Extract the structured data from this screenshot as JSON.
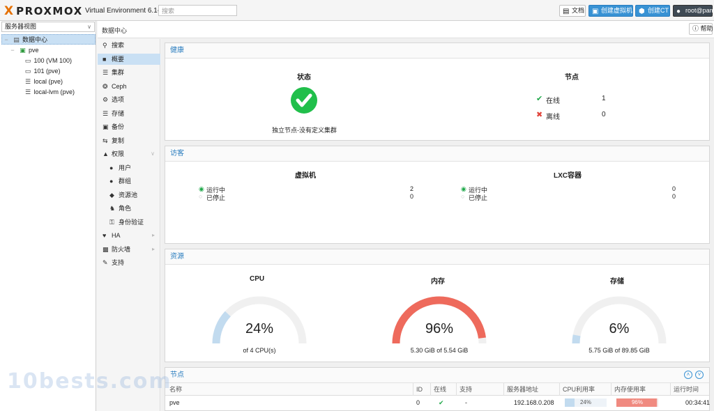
{
  "header": {
    "logo_x": "X",
    "logo_text": "PROXMOX",
    "version": "Virtual Environment 6.1-7",
    "search_placeholder": "搜索",
    "btn_docs": "文档",
    "btn_create_vm": "创建虚拟机",
    "btn_create_ct": "创建CT",
    "btn_user": "root@pam"
  },
  "tree": {
    "view_selector": "服务器视图",
    "items": [
      {
        "label": "数据中心"
      },
      {
        "label": "pve"
      },
      {
        "label": "100 (VM 100)"
      },
      {
        "label": "101 (pve)"
      },
      {
        "label": "local (pve)"
      },
      {
        "label": "local-lvm (pve)"
      }
    ]
  },
  "breadcrumb": "数据中心",
  "help_label": "帮助",
  "menu": {
    "items": [
      {
        "label": "搜索",
        "icon": "search-icon"
      },
      {
        "label": "概要",
        "icon": "book-icon"
      },
      {
        "label": "集群",
        "icon": "server-icon"
      },
      {
        "label": "Ceph",
        "icon": "ceph-icon"
      },
      {
        "label": "选项",
        "icon": "gear-icon"
      },
      {
        "label": "存储",
        "icon": "database-icon"
      },
      {
        "label": "备份",
        "icon": "floppy-icon"
      },
      {
        "label": "复制",
        "icon": "retweet-icon"
      },
      {
        "label": "权限",
        "icon": "unlock-icon"
      },
      {
        "label": "用户",
        "icon": "user-icon"
      },
      {
        "label": "群组",
        "icon": "users-icon"
      },
      {
        "label": "资源池",
        "icon": "tags-icon"
      },
      {
        "label": "角色",
        "icon": "male-icon"
      },
      {
        "label": "身份验证",
        "icon": "key-icon"
      },
      {
        "label": "HA",
        "icon": "heartbeat-icon"
      },
      {
        "label": "防火墙",
        "icon": "shield-icon"
      },
      {
        "label": "支持",
        "icon": "comments-icon"
      }
    ]
  },
  "health": {
    "title": "健康",
    "status_title": "状态",
    "status_text": "独立节点-没有定义集群",
    "nodes_title": "节点",
    "online_label": "在线",
    "online_count": "1",
    "offline_label": "离线",
    "offline_count": "0"
  },
  "guests": {
    "title": "访客",
    "vm_title": "虚拟机",
    "lxc_title": "LXC容器",
    "running_label": "运行中",
    "stopped_label": "已停止",
    "vm_running": "2",
    "vm_stopped": "0",
    "lxc_running": "0",
    "lxc_stopped": "0"
  },
  "resources": {
    "title": "资源",
    "cpu": {
      "title": "CPU",
      "value": "24%",
      "fraction": 0.24,
      "detail": "of 4 CPU(s)",
      "color": "#c2dbef"
    },
    "memory": {
      "title": "内存",
      "value": "96%",
      "fraction": 0.96,
      "detail": "5.30 GiB of 5.54 GiB",
      "color": "#ee6a5c"
    },
    "storage": {
      "title": "存储",
      "value": "6%",
      "fraction": 0.06,
      "detail": "5.75 GiB of 89.85 GiB",
      "color": "#c2dbef"
    }
  },
  "nodes_table": {
    "title": "节点",
    "columns": [
      "名称",
      "ID",
      "在线",
      "支持",
      "服务器地址",
      "CPU利用率",
      "内存使用率",
      "运行时间"
    ],
    "row": {
      "name": "pve",
      "id": "0",
      "support": "-",
      "address": "192.168.0.208",
      "cpu": "24%",
      "cpu_fraction": 0.24,
      "mem": "96%",
      "mem_fraction": 0.96,
      "uptime": "00:34:41"
    }
  },
  "watermark": "10bests.com"
}
